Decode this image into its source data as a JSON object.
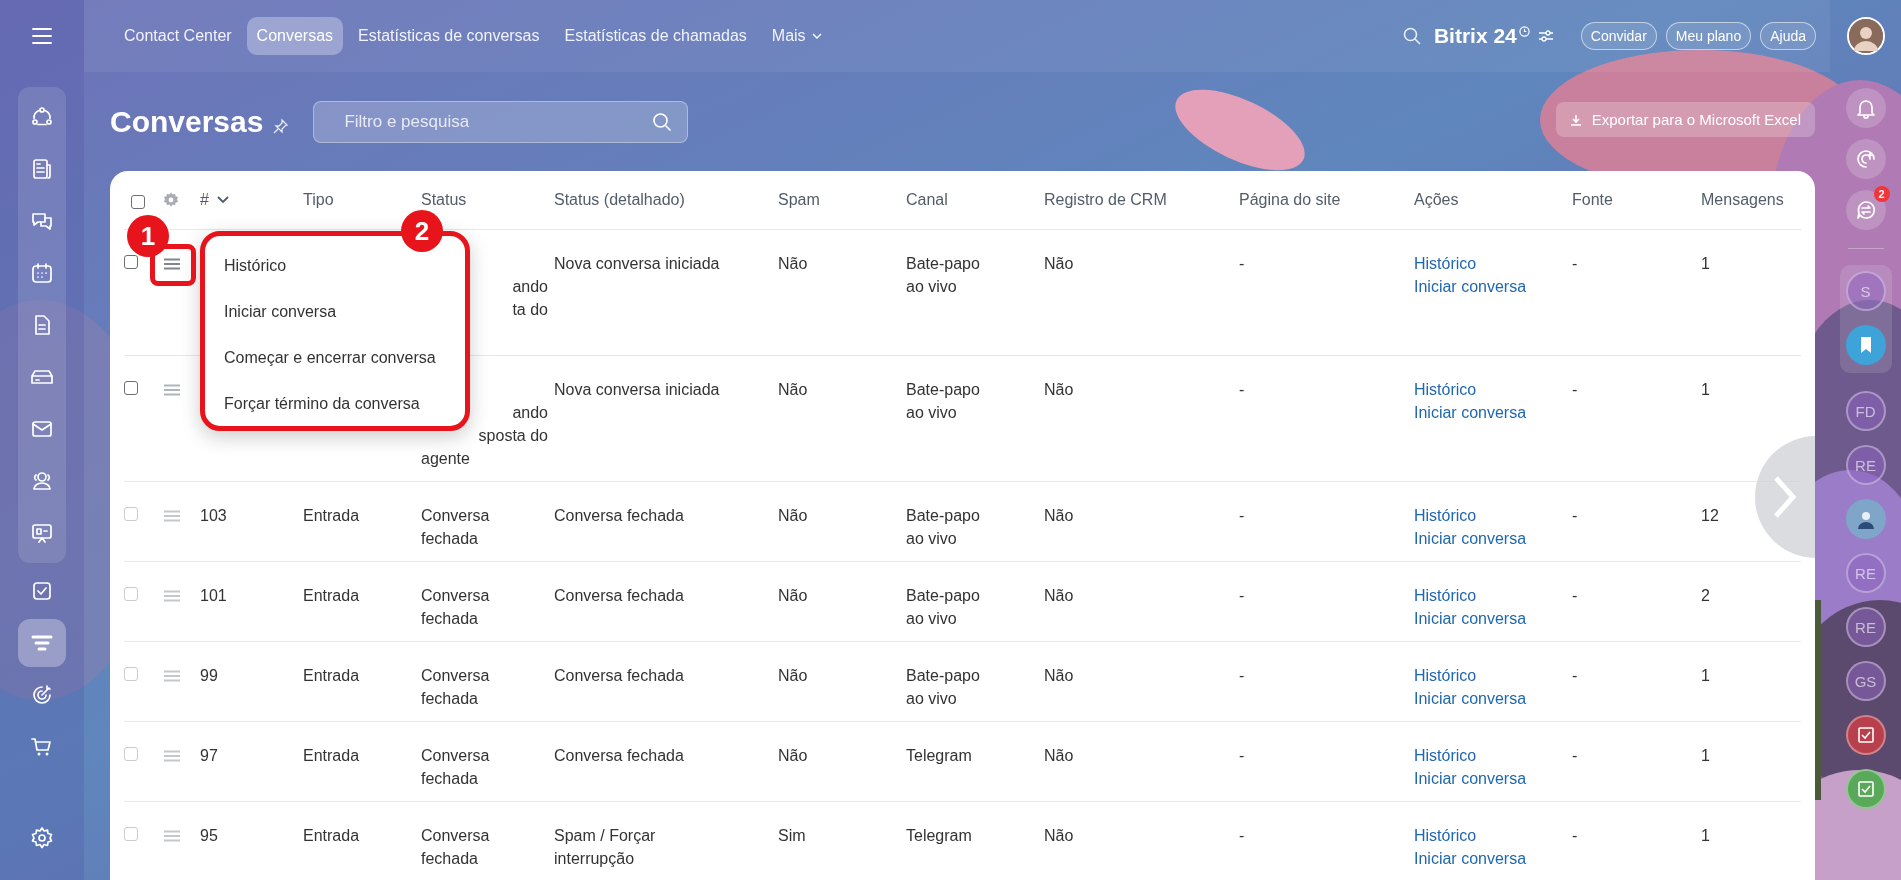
{
  "topbar": {
    "nav": [
      {
        "label": "Contact Center",
        "selected": false
      },
      {
        "label": "Conversas",
        "selected": true
      },
      {
        "label": "Estatísticas de conversas",
        "selected": false
      },
      {
        "label": "Estatísticas de chamadas",
        "selected": false
      },
      {
        "label": "Mais",
        "selected": false,
        "kind": "dropdown"
      }
    ],
    "logo": "Bitrix 24",
    "buttons": [
      "Convidar",
      "Meu plano",
      "Ajuda"
    ]
  },
  "left_sidebar": {
    "group": [
      {
        "selected": false
      },
      {
        "selected": false
      },
      {
        "selected": false
      },
      {
        "selected": false
      },
      {
        "selected": false
      },
      {
        "selected": false
      },
      {
        "selected": false
      },
      {
        "selected": false
      },
      {
        "selected": false
      }
    ],
    "items": [
      {
        "selected": false
      },
      {
        "selected": true
      },
      {
        "selected": false
      },
      {
        "selected": false
      }
    ]
  },
  "page": {
    "title": "Conversas",
    "search": {
      "placeholder": "Filtro e pesquisa"
    },
    "export_button": "Exportar para o Microsoft Excel"
  },
  "table": {
    "select_all": {
      "checked": false
    },
    "columns": [
      "#",
      "Tipo",
      "Status",
      "Status (detalhado)",
      "Spam",
      "Canal",
      "Registro de CRM",
      "Página do site",
      "Ações",
      "Fonte",
      "Mensagens"
    ],
    "rows": [
      {
        "disabled": false,
        "menu_open": true,
        "status_fragments": [
          {
            "text": "ando",
            "cut": true
          },
          {
            "text": "ta do",
            "cut": true
          }
        ],
        "status_detail": "Nova conversa iniciada",
        "spam": "Não",
        "channel": "Bate-papo ao vivo",
        "crm": "Não",
        "site_page": "-",
        "actions": [
          "Histórico",
          "Iniciar conversa"
        ],
        "source": "-",
        "messages": "1"
      },
      {
        "disabled": false,
        "menu_open": false,
        "status_fragments": [
          {
            "text": "ando",
            "cut": true
          },
          {
            "text": "sposta do",
            "cut": true
          },
          {
            "text": "agente",
            "cut": false
          }
        ],
        "status_detail": "Nova conversa iniciada",
        "spam": "Não",
        "channel": "Bate-papo ao vivo",
        "crm": "Não",
        "site_page": "-",
        "actions": [
          "Histórico",
          "Iniciar conversa"
        ],
        "source": "-",
        "messages": "1"
      },
      {
        "disabled": true,
        "menu_open": false,
        "id": "103",
        "type": "Entrada",
        "status": "Conversa fechada",
        "status_detail": "Conversa fechada",
        "spam": "Não",
        "channel": "Bate-papo ao vivo",
        "crm": "Não",
        "site_page": "-",
        "actions": [
          "Histórico",
          "Iniciar conversa"
        ],
        "source": "-",
        "messages": "12"
      },
      {
        "disabled": true,
        "menu_open": false,
        "id": "101",
        "type": "Entrada",
        "status": "Conversa fechada",
        "status_detail": "Conversa fechada",
        "spam": "Não",
        "channel": "Bate-papo ao vivo",
        "crm": "Não",
        "site_page": "-",
        "actions": [
          "Histórico",
          "Iniciar conversa"
        ],
        "source": "-",
        "messages": "2"
      },
      {
        "disabled": true,
        "menu_open": false,
        "id": "99",
        "type": "Entrada",
        "status": "Conversa fechada",
        "status_detail": "Conversa fechada",
        "spam": "Não",
        "channel": "Bate-papo ao vivo",
        "crm": "Não",
        "site_page": "-",
        "actions": [
          "Histórico",
          "Iniciar conversa"
        ],
        "source": "-",
        "messages": "1"
      },
      {
        "disabled": true,
        "menu_open": false,
        "id": "97",
        "type": "Entrada",
        "status": "Conversa fechada",
        "status_detail": "Conversa fechada",
        "spam": "Não",
        "channel": "Telegram",
        "crm": "Não",
        "site_page": "-",
        "actions": [
          "Histórico",
          "Iniciar conversa"
        ],
        "source": "-",
        "messages": "1"
      },
      {
        "disabled": true,
        "menu_open": false,
        "id": "95",
        "type": "Entrada",
        "status": "Conversa fechada",
        "status_detail": "Spam / Forçar interrupção",
        "spam": "Sim",
        "channel": "Telegram",
        "crm": "Não",
        "site_page": "-",
        "actions": [
          "Histórico",
          "Iniciar conversa"
        ],
        "source": "-",
        "messages": "1"
      }
    ]
  },
  "row_menu": {
    "items": [
      "Histórico",
      "Iniciar conversa",
      "Começar e encerrar conversa",
      "Forçar término da conversa"
    ]
  },
  "annotations": [
    "1",
    "2"
  ],
  "right_sidebar": {
    "notification_badge": "2",
    "items": [
      {
        "kind": "initials",
        "label": "S",
        "grouped": true
      },
      {
        "kind": "bookmark",
        "grouped": true
      },
      {
        "kind": "initials",
        "label": "FD",
        "grouped": false
      },
      {
        "kind": "initials",
        "label": "RE",
        "grouped": false
      },
      {
        "kind": "avatar",
        "grouped": false
      },
      {
        "kind": "initials",
        "label": "RE",
        "grouped": false
      },
      {
        "kind": "initials",
        "label": "RE",
        "grouped": false
      },
      {
        "kind": "initials",
        "label": "GS",
        "grouped": false
      },
      {
        "kind": "task",
        "color": "#b8404c",
        "grouped": false
      },
      {
        "kind": "task",
        "color": "#5aa85a",
        "grouped": false
      }
    ]
  }
}
